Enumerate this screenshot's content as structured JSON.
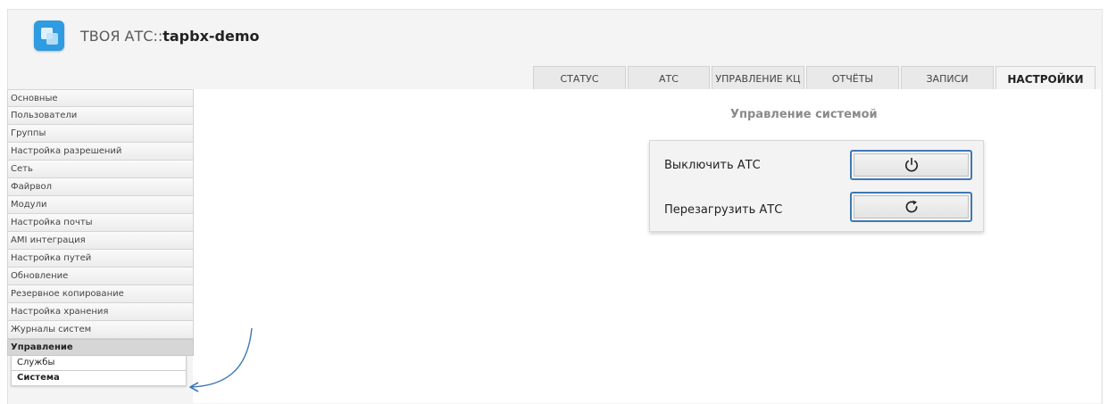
{
  "header": {
    "app_name": "ТВОЯ АТС::",
    "instance": "tapbx-demo"
  },
  "tabs": [
    {
      "label": "СТАТУС"
    },
    {
      "label": "АТС"
    },
    {
      "label": "УПРАВЛЕНИЕ КЦ"
    },
    {
      "label": "ОТЧЁТЫ"
    },
    {
      "label": "ЗАПИСИ"
    },
    {
      "label": "НАСТРОЙКИ",
      "active": true
    }
  ],
  "sidebar": {
    "items": [
      "Основные",
      "Пользователи",
      "Группы",
      "Настройка разрешений",
      "Сеть",
      "Файрвол",
      "Модули",
      "Настройка почты",
      "AMI интеграция",
      "Настройка путей",
      "Обновление",
      "Резервное копирование",
      "Настройка хранения",
      "Журналы систем"
    ],
    "group_label": "Управление",
    "sub_items": [
      "Службы",
      "Система"
    ],
    "active_sub": "Система"
  },
  "main": {
    "title": "Управление системой",
    "rows": [
      {
        "label": "Выключить АТС",
        "icon": "power-icon"
      },
      {
        "label": "Перезагрузить АТС",
        "icon": "reload-icon"
      }
    ]
  },
  "colors": {
    "accent_border": "#3f78b3",
    "logo": "#2f9be0",
    "annotation_arrow": "#3f78b3"
  }
}
